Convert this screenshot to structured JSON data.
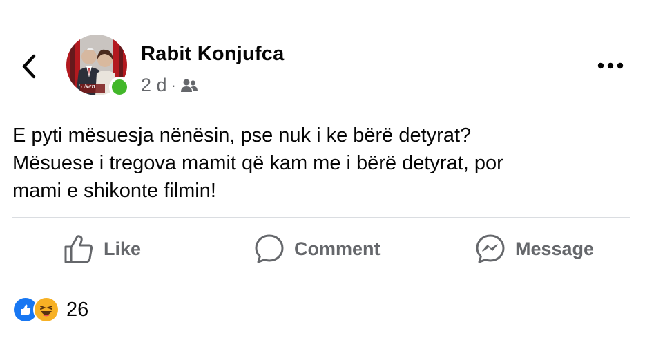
{
  "post": {
    "author_name": "Rabit Konjufca",
    "timestamp": "2 d",
    "separator": "·",
    "audience_icon": "friends-icon",
    "avatar_overlay_text": "5 Nen",
    "text_lines": [
      "E pyti mësuesja nënësin, pse nuk i ke bërë detyrat?",
      "Mësuese i tregova mamit që kam me i bërë detyrat, por",
      "mami e shikonte filmin!"
    ]
  },
  "actions": {
    "like_label": "Like",
    "comment_label": "Comment",
    "message_label": "Message"
  },
  "reactions": {
    "types": [
      "like-icon",
      "haha-icon"
    ],
    "count": "26"
  },
  "colors": {
    "text_primary": "#050505",
    "text_secondary": "#65676b",
    "online": "#42b72a",
    "like_blue": "#1877f2",
    "haha_yellow": "#f7b125",
    "divider": "#dadde1"
  }
}
